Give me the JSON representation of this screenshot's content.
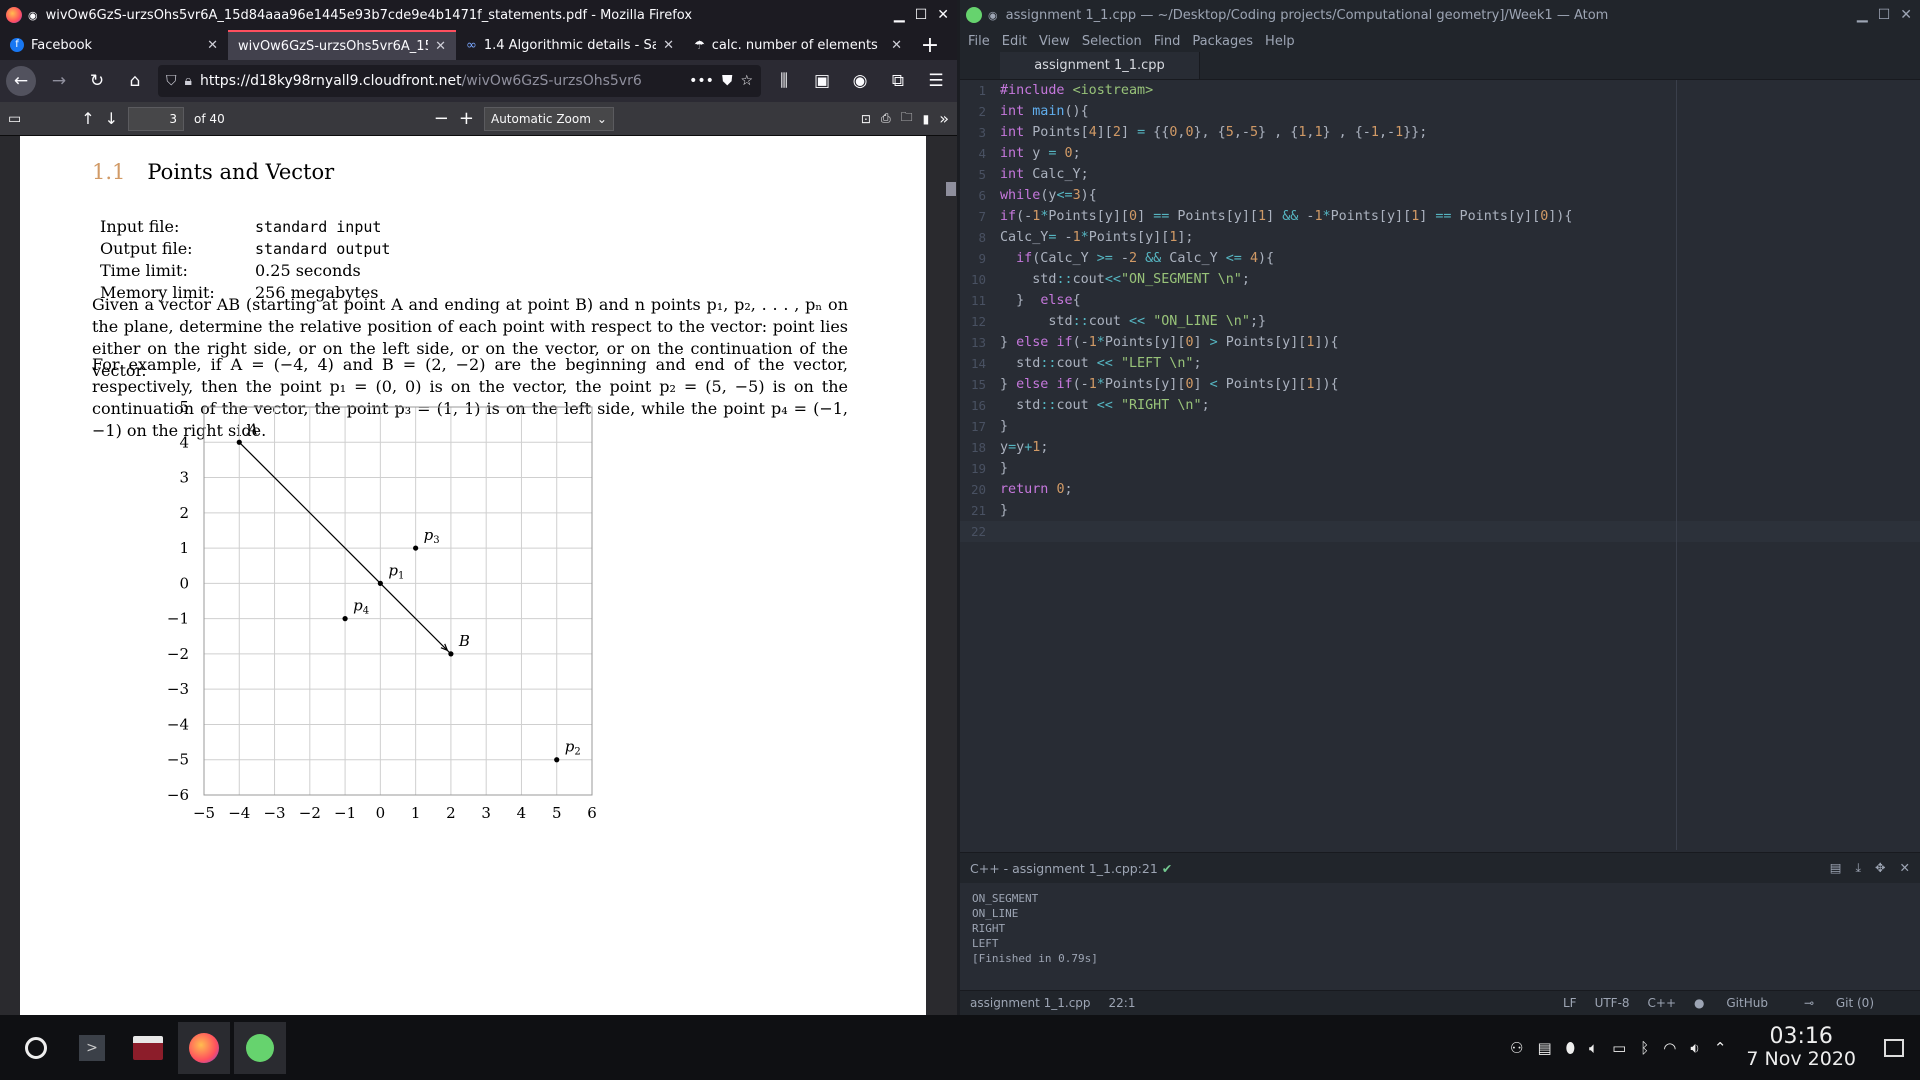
{
  "firefox": {
    "window_title": "wivOw6GzS-urzsOhs5vr6A_15d84aaa96e1445e93b7cde9e4b1471f_statements.pdf - Mozilla Firefox",
    "tabs": [
      {
        "label": "Facebook",
        "icon": "facebook-icon"
      },
      {
        "label": "wivOw6GzS-urzsOhs5vr6A_15",
        "icon": "pdf-icon"
      },
      {
        "label": "1.4 Algorithmic details - Sa",
        "icon": "coursera-icon"
      },
      {
        "label": "calc. number of elements",
        "icon": "mask-icon"
      }
    ],
    "url_host": "https://d18ky98rnyall9.cloudfront.net",
    "url_path": "/wivOw6GzS-urzsOhs5vr6",
    "pdf": {
      "page": "3",
      "of": "of 40",
      "zoom": "Automatic Zoom"
    }
  },
  "doc": {
    "section_num": "1.1",
    "section_title": "Points and Vector",
    "meta": [
      {
        "k": "Input file:",
        "v": "standard input",
        "mono": true
      },
      {
        "k": "Output file:",
        "v": "standard output",
        "mono": true
      },
      {
        "k": "Time limit:",
        "v": "0.25 seconds",
        "mono": false
      },
      {
        "k": "Memory limit:",
        "v": "256 megabytes",
        "mono": false
      }
    ],
    "para1": "Given a vector AB (starting at point A and ending at point B) and n points p₁, p₂, . . . , pₙ on the plane, determine the relative position of each point with respect to the vector: point lies either on the right side, or on the left side, or on the vector, or on the continuation of the vector.",
    "para2": "For example, if A = (−4, 4) and B = (2, −2) are the beginning and end of the vector, respectively, then the point p₁ = (0, 0) is on the vector, the point p₂ = (5, −5) is on the continuation of the vector, the point p₃ = (1, 1) is on the left side, while the point p₄ = (−1, −1) on the right side."
  },
  "chart_data": {
    "type": "scatter",
    "xlim": [
      -5,
      6
    ],
    "ylim": [
      -6,
      5
    ],
    "x_ticks": [
      "−5",
      "−4",
      "−3",
      "−2",
      "−1",
      "0",
      "1",
      "2",
      "3",
      "4",
      "5",
      "6"
    ],
    "y_ticks": [
      "5",
      "4",
      "3",
      "2",
      "1",
      "0",
      "−1",
      "−2",
      "−3",
      "−4",
      "−5",
      "−6"
    ],
    "grid": true,
    "points": [
      {
        "label": "A",
        "x": -4,
        "y": 4
      },
      {
        "label": "B",
        "x": 2,
        "y": -2
      },
      {
        "label": "p1",
        "x": 0,
        "y": 0
      },
      {
        "label": "p2",
        "x": 5,
        "y": -5
      },
      {
        "label": "p3",
        "x": 1,
        "y": 1
      },
      {
        "label": "p4",
        "x": -1,
        "y": -1
      }
    ],
    "vector": {
      "from": "A",
      "to": "B"
    }
  },
  "atom": {
    "window_title": "assignment 1_1.cpp — ~/Desktop/Coding projects/Computational geometry]/Week1 — Atom",
    "menu": [
      "File",
      "Edit",
      "View",
      "Selection",
      "Find",
      "Packages",
      "Help"
    ],
    "tab": "assignment 1_1.cpp",
    "code": [
      "#include <iostream>",
      "int main(){",
      "int Points[4][2] = {{0,0}, {5,-5} , {1,1} , {-1,-1}};",
      "int y = 0;",
      "int Calc_Y;",
      "while(y<=3){",
      "if(-1*Points[y][0] == Points[y][1] && -1*Points[y][1] == Points[y][0]){",
      "Calc_Y= -1*Points[y][1];",
      "  if(Calc_Y >= -2 && Calc_Y <= 4){",
      "    std::cout<<\"ON_SEGMENT \\n\";",
      "  }  else{",
      "      std::cout << \"ON_LINE \\n\";}",
      "} else if(-1*Points[y][0] > Points[y][1]){",
      "  std::cout << \"LEFT \\n\";",
      "} else if(-1*Points[y][0] < Points[y][1]){",
      "  std::cout << \"RIGHT \\n\";",
      "}",
      "y=y+1;",
      "}",
      "return 0;",
      "}",
      ""
    ],
    "panel_title": "C++ - assignment 1_1.cpp:21",
    "output": "ON_SEGMENT\nON_LINE\nRIGHT\nLEFT\n[Finished in 0.79s]",
    "status": {
      "file": "assignment 1_1.cpp",
      "pos": "22:1",
      "eol": "LF",
      "enc": "UTF-8",
      "grammar": "C++",
      "github": "GitHub",
      "git": "Git (0)"
    }
  },
  "taskbar": {
    "time": "03:16",
    "date": "7 Nov 2020"
  }
}
